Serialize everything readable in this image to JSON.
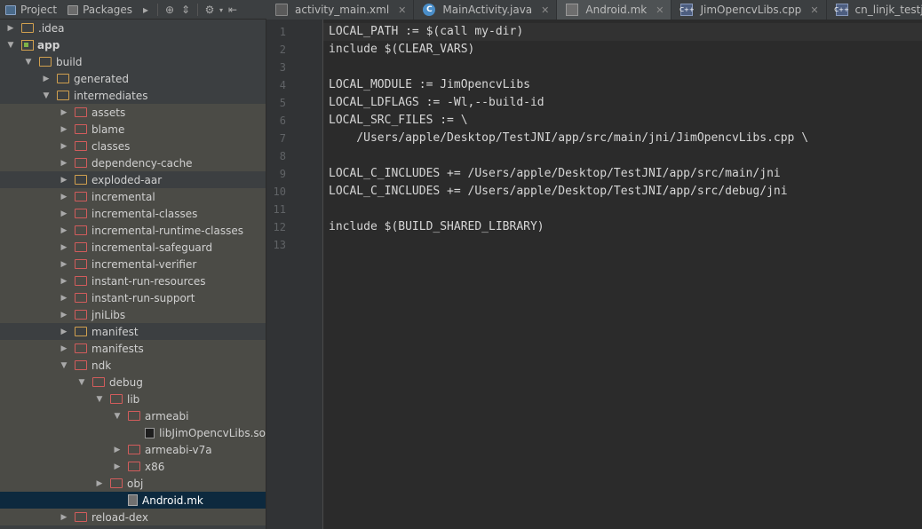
{
  "toolwindow": {
    "project_tab": "Project",
    "packages_tab": "Packages"
  },
  "editor_tabs": [
    {
      "label": "activity_main.xml",
      "type": "xml",
      "active": false
    },
    {
      "label": "MainActivity.java",
      "type": "java",
      "active": false,
      "icon_text": "C"
    },
    {
      "label": "Android.mk",
      "type": "mk",
      "active": true
    },
    {
      "label": "JimOpencvLibs.cpp",
      "type": "cpp",
      "active": false,
      "icon_text": "C++"
    },
    {
      "label": "cn_linjk_testjni_MainAc",
      "type": "cpp",
      "active": false,
      "icon_text": "C++"
    }
  ],
  "tree": [
    {
      "label": ".idea",
      "depth": 0,
      "arrow": "right",
      "icon": "folder-yellow",
      "band": false
    },
    {
      "label": "app",
      "depth": 0,
      "arrow": "down",
      "icon": "module",
      "band": false
    },
    {
      "label": "build",
      "depth": 1,
      "arrow": "down",
      "icon": "folder-yellow",
      "band": false
    },
    {
      "label": "generated",
      "depth": 2,
      "arrow": "right",
      "icon": "folder-yellow",
      "band": false
    },
    {
      "label": "intermediates",
      "depth": 2,
      "arrow": "down",
      "icon": "folder-yellow",
      "band": false
    },
    {
      "label": "assets",
      "depth": 3,
      "arrow": "right",
      "icon": "folder-red",
      "band": true
    },
    {
      "label": "blame",
      "depth": 3,
      "arrow": "right",
      "icon": "folder-red",
      "band": true
    },
    {
      "label": "classes",
      "depth": 3,
      "arrow": "right",
      "icon": "folder-red",
      "band": true
    },
    {
      "label": "dependency-cache",
      "depth": 3,
      "arrow": "right",
      "icon": "folder-red",
      "band": true
    },
    {
      "label": "exploded-aar",
      "depth": 3,
      "arrow": "right",
      "icon": "folder-yellow",
      "band": false
    },
    {
      "label": "incremental",
      "depth": 3,
      "arrow": "right",
      "icon": "folder-red",
      "band": true
    },
    {
      "label": "incremental-classes",
      "depth": 3,
      "arrow": "right",
      "icon": "folder-red",
      "band": true
    },
    {
      "label": "incremental-runtime-classes",
      "depth": 3,
      "arrow": "right",
      "icon": "folder-red",
      "band": true
    },
    {
      "label": "incremental-safeguard",
      "depth": 3,
      "arrow": "right",
      "icon": "folder-red",
      "band": true
    },
    {
      "label": "incremental-verifier",
      "depth": 3,
      "arrow": "right",
      "icon": "folder-red",
      "band": true
    },
    {
      "label": "instant-run-resources",
      "depth": 3,
      "arrow": "right",
      "icon": "folder-red",
      "band": true
    },
    {
      "label": "instant-run-support",
      "depth": 3,
      "arrow": "right",
      "icon": "folder-red",
      "band": true
    },
    {
      "label": "jniLibs",
      "depth": 3,
      "arrow": "right",
      "icon": "folder-red",
      "band": true
    },
    {
      "label": "manifest",
      "depth": 3,
      "arrow": "right",
      "icon": "folder-yellow",
      "band": false
    },
    {
      "label": "manifests",
      "depth": 3,
      "arrow": "right",
      "icon": "folder-red",
      "band": true
    },
    {
      "label": "ndk",
      "depth": 3,
      "arrow": "down",
      "icon": "folder-red",
      "band": true
    },
    {
      "label": "debug",
      "depth": 4,
      "arrow": "down",
      "icon": "folder-red",
      "band": true
    },
    {
      "label": "lib",
      "depth": 5,
      "arrow": "down",
      "icon": "folder-red",
      "band": true
    },
    {
      "label": "armeabi",
      "depth": 6,
      "arrow": "down",
      "icon": "folder-red",
      "band": true
    },
    {
      "label": "libJimOpencvLibs.so",
      "depth": 7,
      "arrow": "none",
      "icon": "file-so",
      "band": true
    },
    {
      "label": "armeabi-v7a",
      "depth": 6,
      "arrow": "right",
      "icon": "folder-red",
      "band": true
    },
    {
      "label": "x86",
      "depth": 6,
      "arrow": "right",
      "icon": "folder-red",
      "band": true
    },
    {
      "label": "obj",
      "depth": 5,
      "arrow": "right",
      "icon": "folder-red",
      "band": true
    },
    {
      "label": "Android.mk",
      "depth": 6,
      "arrow": "none",
      "icon": "file-mk",
      "band": false,
      "selected": true
    },
    {
      "label": "reload-dex",
      "depth": 3,
      "arrow": "right",
      "icon": "folder-red",
      "band": true
    }
  ],
  "editor": {
    "lines": [
      "LOCAL_PATH := $(call my-dir)",
      "include $(CLEAR_VARS)",
      "",
      "LOCAL_MODULE := JimOpencvLibs",
      "LOCAL_LDFLAGS := -Wl,--build-id",
      "LOCAL_SRC_FILES := \\",
      "    /Users/apple/Desktop/TestJNI/app/src/main/jni/JimOpencvLibs.cpp \\",
      "",
      "LOCAL_C_INCLUDES += /Users/apple/Desktop/TestJNI/app/src/main/jni",
      "LOCAL_C_INCLUDES += /Users/apple/Desktop/TestJNI/app/src/debug/jni",
      "",
      "include $(BUILD_SHARED_LIBRARY)",
      ""
    ]
  }
}
